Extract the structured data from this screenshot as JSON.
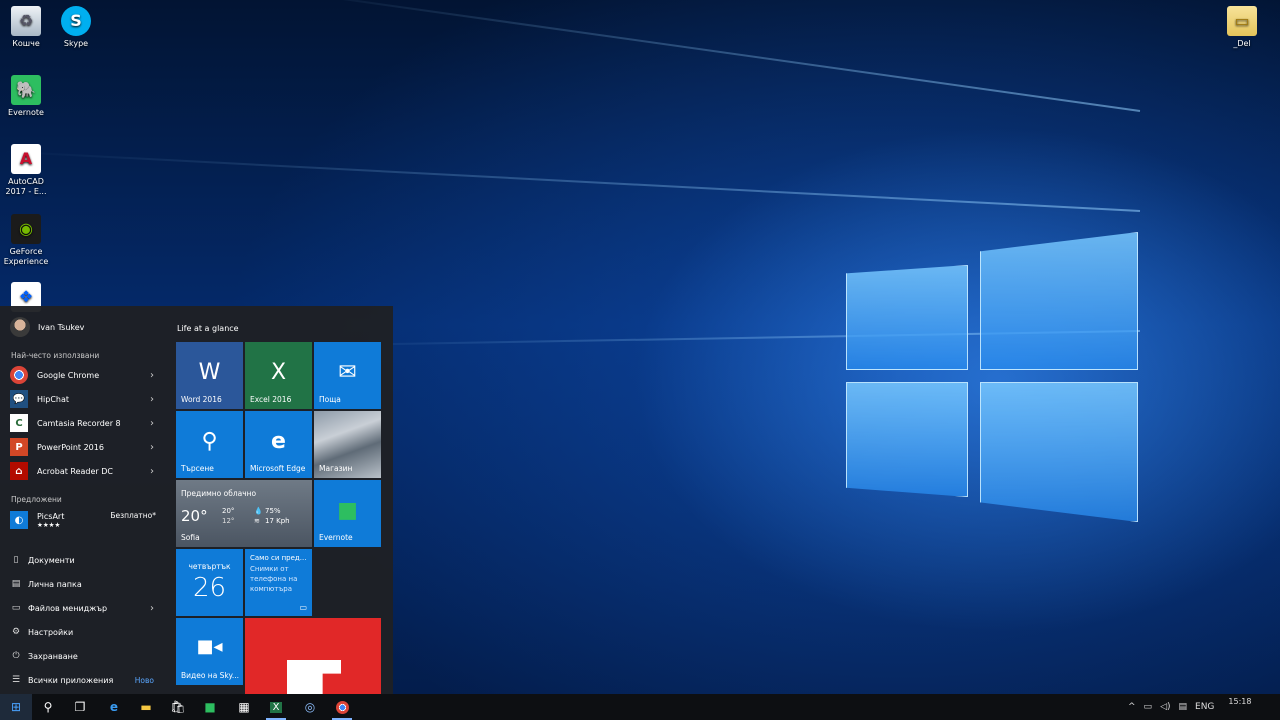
{
  "desktop": {
    "icons": [
      {
        "label": "Кошче"
      },
      {
        "label": "Skype"
      },
      {
        "label": "Evernote"
      },
      {
        "label": "AutoCAD 2017 - E..."
      },
      {
        "label": "GeForce Experience"
      },
      {
        "label": ""
      },
      {
        "label": "_Del"
      }
    ]
  },
  "start_menu": {
    "user_name": "Ivan Tsukev",
    "most_used_label": "Най-често използвани",
    "most_used": [
      {
        "label": "Google Chrome"
      },
      {
        "label": "HipChat"
      },
      {
        "label": "Camtasia Recorder 8"
      },
      {
        "label": "PowerPoint 2016"
      },
      {
        "label": "Acrobat Reader DC"
      }
    ],
    "suggested_label": "Предложени",
    "suggestion": {
      "name": "PicsArt",
      "rating": "★★★★",
      "price": "Безплатно*"
    },
    "system": [
      {
        "label": "Документи"
      },
      {
        "label": "Лична папка"
      },
      {
        "label": "Файлов мениджър"
      },
      {
        "label": "Настройки"
      },
      {
        "label": "Захранване"
      },
      {
        "label": "Всички приложения"
      }
    ],
    "new_badge": "Ново",
    "tiles_group": "Life at a glance",
    "tiles": {
      "word": "Word 2016",
      "excel": "Excel 2016",
      "mail": "Поща",
      "search": "Търсене",
      "edge": "Microsoft Edge",
      "store": "Магазин",
      "weather_cond": "Предимно облачно",
      "weather_temp": "20°",
      "weather_high": "20°",
      "weather_low": "12°",
      "weather_hum": "75%",
      "weather_wind": "17 Kph",
      "weather_city": "Sofia",
      "evernote": "Evernote",
      "cal_day": "четвъртък",
      "cal_date": "26",
      "photos_title": "Само си пред...",
      "photos_body": "Снимки от телефона на компютъра",
      "skype_video": "Видео на Sky..."
    }
  },
  "taskbar": {
    "language": "ENG",
    "time": "15:18"
  },
  "colors": {
    "accent": "#0f7bd8",
    "word": "#2b579a",
    "excel": "#217346",
    "flipboard": "#e12828",
    "evernote_tile": "#0f7bd8"
  }
}
